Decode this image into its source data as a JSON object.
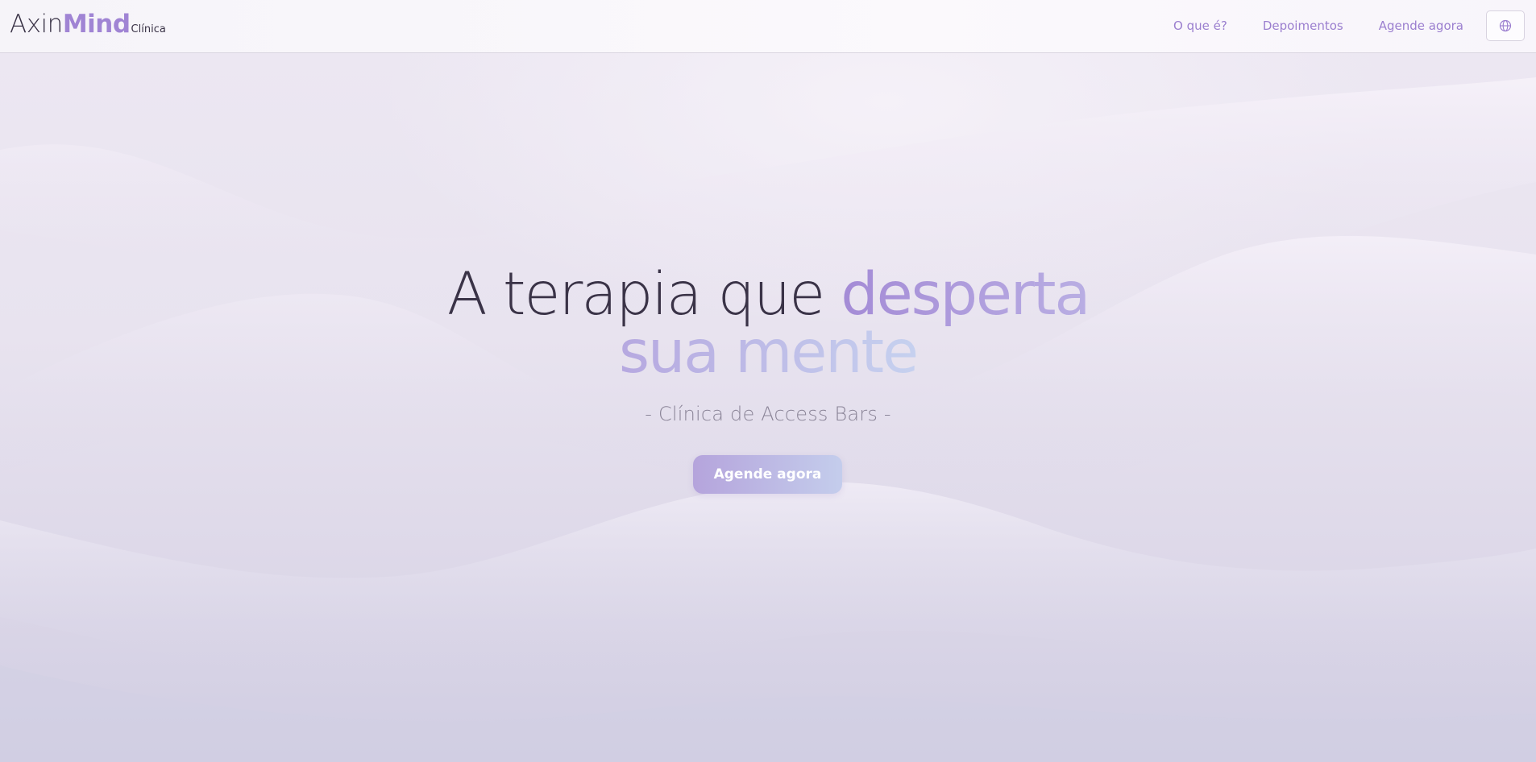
{
  "brand": {
    "name_part1": "Axin",
    "name_part2": "Mind",
    "suffix": "Clínica",
    "accent_color": "#a084d4"
  },
  "nav": {
    "links": [
      {
        "label": "O que é?"
      },
      {
        "label": "Depoimentos"
      },
      {
        "label": "Agende agora"
      }
    ],
    "language_icon": "globe-icon"
  },
  "hero": {
    "headline_plain": "A terapia que ",
    "headline_accent1": "desperta",
    "headline_accent2": "sua mente",
    "subtitle": "- Clínica de Access Bars -",
    "cta_label": "Agende agora"
  }
}
